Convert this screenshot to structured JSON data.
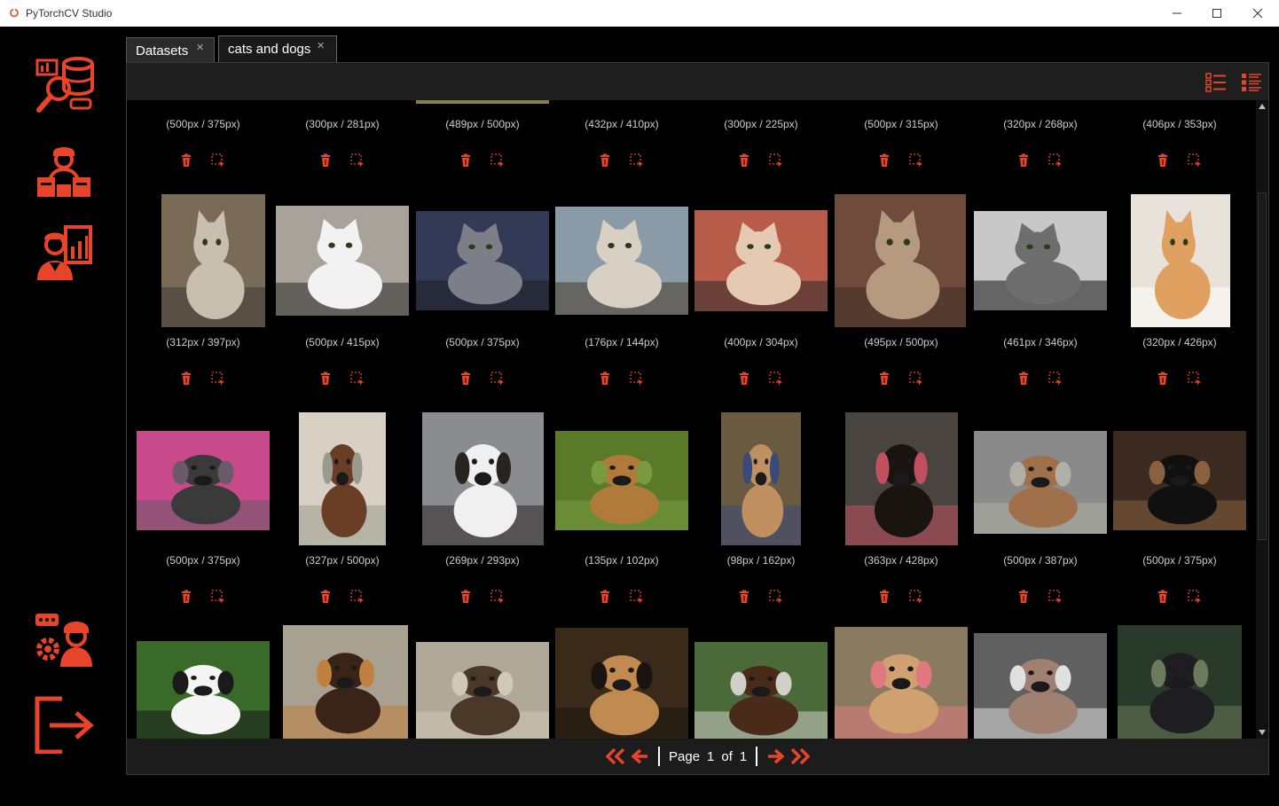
{
  "window": {
    "title": "PyTorchCV Studio"
  },
  "colors": {
    "accent": "#e8442a",
    "background": "#000000",
    "panel": "#1c1c1c"
  },
  "sidebar": {
    "items": [
      {
        "icon": "dataset-search-icon"
      },
      {
        "icon": "annotator-team-icon"
      },
      {
        "icon": "analyst-report-icon"
      },
      {
        "icon": "settings-user-icon"
      },
      {
        "icon": "logout-icon"
      }
    ]
  },
  "tabs": [
    {
      "label": "Datasets",
      "close": "✕"
    },
    {
      "label": "cats and dogs",
      "close": "✕"
    }
  ],
  "toolbar": {
    "icons": [
      "list-view-icon",
      "detail-list-icon"
    ]
  },
  "grid": {
    "rows": [
      {
        "sizes": [
          "(500px / 375px)",
          "(300px / 281px)",
          "(489px / 500px)",
          "(432px / 410px)",
          "(300px / 225px)",
          "(500px / 315px)",
          "(320px / 268px)",
          "(406px / 353px)"
        ]
      },
      {
        "sizes": [
          "(312px / 397px)",
          "(500px / 415px)",
          "(500px / 375px)",
          "(176px / 144px)",
          "(400px / 304px)",
          "(495px / 500px)",
          "(461px / 346px)",
          "(320px / 426px)"
        ]
      },
      {
        "sizes": [
          "(500px / 375px)",
          "(327px / 500px)",
          "(269px / 293px)",
          "(135px / 102px)",
          "(98px / 162px)",
          "(363px / 428px)",
          "(500px / 387px)",
          "(500px / 375px)"
        ]
      }
    ],
    "image_rows": [
      [
        "cat",
        "cat",
        "cat",
        "cat",
        "cat",
        "cat",
        "cat",
        "cat"
      ],
      [
        "dog",
        "dog",
        "dog",
        "dog",
        "dog",
        "dog",
        "dog",
        "dog"
      ],
      [
        "dog",
        "dog",
        "dog",
        "dog",
        "dog",
        "dog",
        "dog",
        "dog"
      ]
    ]
  },
  "pagination": {
    "page_label": "Page",
    "current": "1",
    "of_label": "of",
    "total": "1"
  }
}
